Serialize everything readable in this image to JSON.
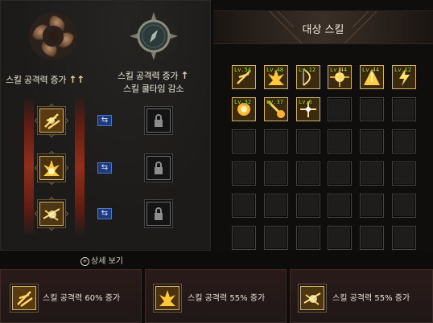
{
  "left": {
    "attack_up_label": "스킬 공격력 증가",
    "attack_up_cooldown_label_1": "스킬 공격력 증가",
    "attack_up_cooldown_label_2": "스킬 쿨타임 감소",
    "up_arrow": "↑",
    "swap_glyph": "⇆",
    "detail_link": "상세 보기"
  },
  "right": {
    "header_title": "대상 스킬",
    "skills": [
      {
        "level": "Lv.54",
        "icon": "fire-slash-icon"
      },
      {
        "level": "Lv.48",
        "icon": "flame-burst-icon"
      },
      {
        "level": "Lv.12",
        "icon": "bow-icon"
      },
      {
        "level": "Lv.44",
        "icon": "spark-icon"
      },
      {
        "level": "Lv.44",
        "icon": "shatter-icon"
      },
      {
        "level": "Lv.12",
        "icon": "lightning-icon"
      },
      {
        "level": "Lv.32",
        "icon": "blast-icon"
      },
      {
        "level": "Lv.37",
        "icon": "meteor-icon"
      },
      {
        "level": "Lv.6",
        "icon": "crossbow-icon"
      }
    ]
  },
  "bottom": [
    {
      "label": "스킬 공격력 60% 증가",
      "icon": "fire-slash-icon"
    },
    {
      "label": "스킬 공격력 55% 증가",
      "icon": "flame-burst-icon"
    },
    {
      "label": "스킬 공격력 55% 증가",
      "icon": "arrow-burst-icon"
    }
  ],
  "colors": {
    "gold_border": "#d4b26a",
    "level_text": "#b8ff2a",
    "swap_blue": "#1e3a7a"
  }
}
